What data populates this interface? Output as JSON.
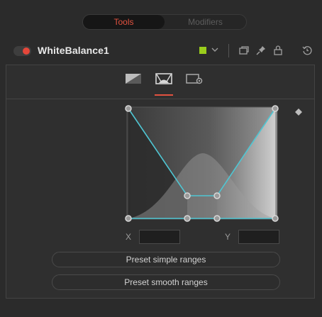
{
  "tabs": {
    "tools_label": "Tools",
    "modifiers_label": "Modifiers"
  },
  "header": {
    "node_name": "WhiteBalance1",
    "toggle_state": "on",
    "node_color": "#9acd1c",
    "icons": [
      "color-dropdown-chevron-icon",
      "copy-icon",
      "pin-icon",
      "lock-icon",
      "reset-icon"
    ]
  },
  "modes": {
    "items": [
      "gradient-mode-icon",
      "ranges-curve-mode-icon",
      "settings-mode-icon"
    ],
    "active_index": 1,
    "accent_color": "#e2523f"
  },
  "ranges": {
    "x_label": "X",
    "x_value": "",
    "y_label": "Y",
    "y_value": "",
    "curve_color": "#4fc6d3"
  },
  "buttons": {
    "preset_simple": "Preset simple ranges",
    "preset_smooth": "Preset smooth ranges"
  }
}
